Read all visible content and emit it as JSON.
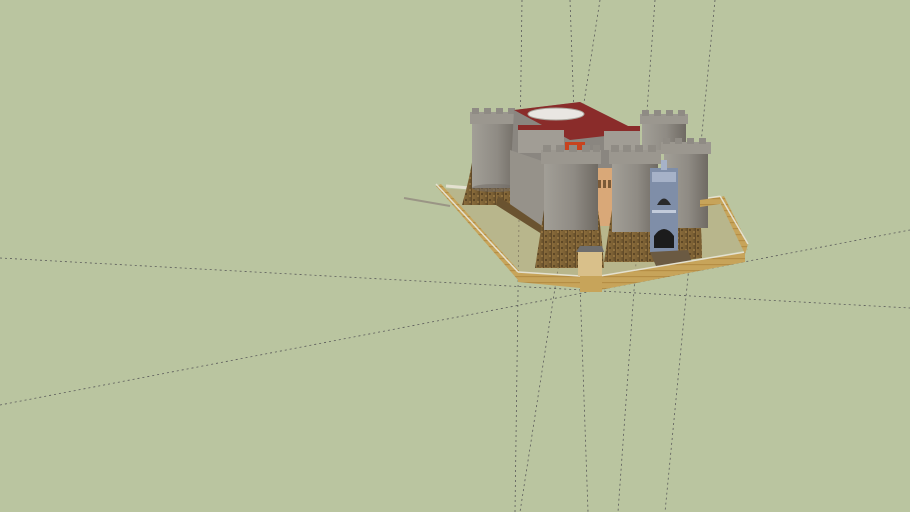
{
  "viewport": {
    "background_color": "#bac5a0",
    "axis_color": "#5a5a5a"
  },
  "model": {
    "stone_color": "#8f8b84",
    "stone_shadow_color": "#6f6a63",
    "base_color": "#7b6034",
    "roof_color": "#8a2c2a",
    "wall_color": "#c7a45a",
    "wall_edge_color": "#e4e1d0",
    "gate_color": "#7f8ea8",
    "accent_color": "#d9a878"
  }
}
